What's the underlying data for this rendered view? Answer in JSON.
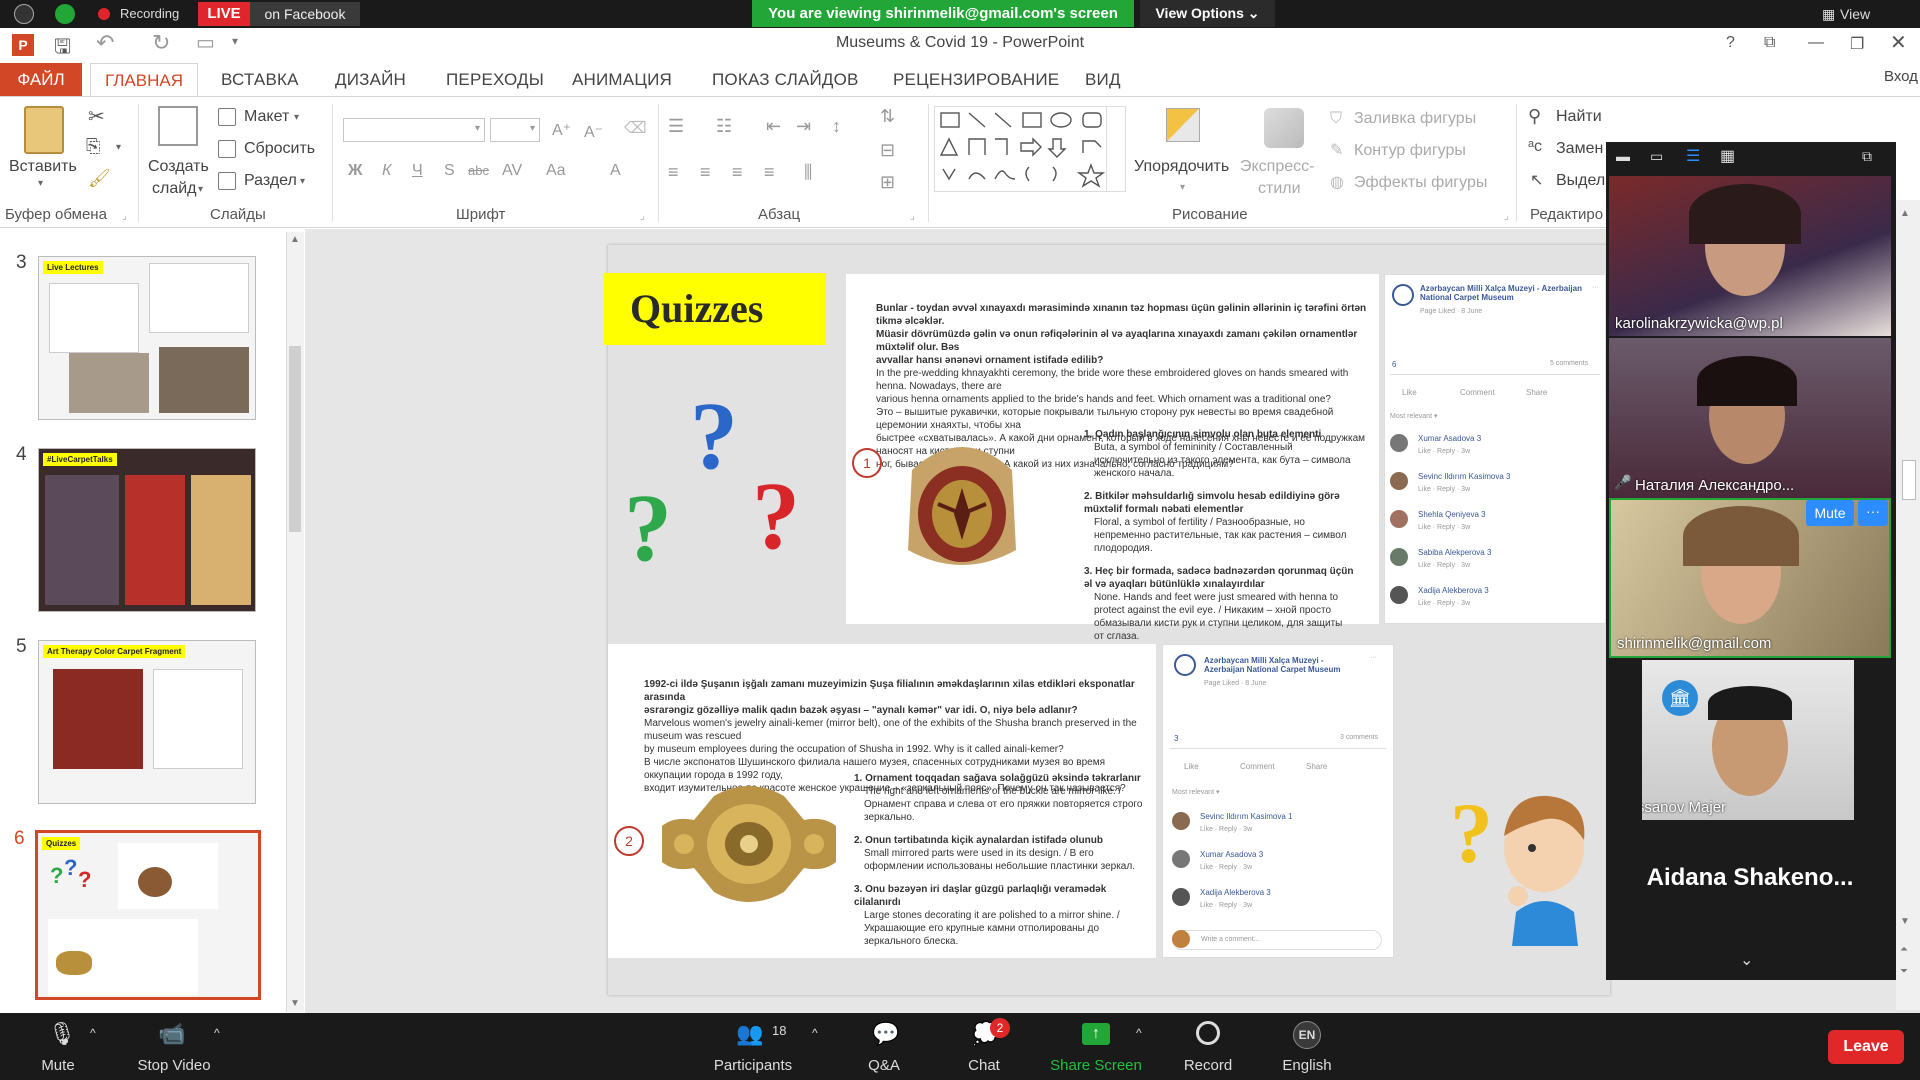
{
  "zoom_top": {
    "recording_label": "Recording",
    "live_label": "LIVE",
    "live_platform": "on Facebook",
    "share_banner": "You are viewing shirinmelik@gmail.com's screen",
    "view_options": "View Options ⌄",
    "view_label": "View"
  },
  "app": {
    "title": "Museums & Covid 19 - PowerPoint",
    "login": "Вход"
  },
  "tabs": [
    "ФАЙЛ",
    "ГЛАВНАЯ",
    "ВСТАВКА",
    "ДИЗАЙН",
    "ПЕРЕХОДЫ",
    "АНИМАЦИЯ",
    "ПОКАЗ СЛАЙДОВ",
    "РЕЦЕНЗИРОВАНИЕ",
    "ВИД"
  ],
  "ribbon": {
    "paste": "Вставить",
    "new_slide_1": "Создать",
    "new_slide_2": "слайд",
    "layout": "Макет",
    "reset": "Сбросить",
    "section": "Раздел",
    "arrange": "Упорядочить",
    "quick_styles_1": "Экспресс-",
    "quick_styles_2": "стили",
    "shape_fill": "Заливка фигуры",
    "shape_outline": "Контур фигуры",
    "shape_effects": "Эффекты фигуры",
    "find": "Найти",
    "replace": "Замен",
    "select": "Выдел",
    "groups": {
      "clipboard": "Буфер обмена",
      "slides": "Слайды",
      "font": "Шрифт",
      "paragraph": "Абзац",
      "drawing": "Рисование",
      "editing": "Редактиро"
    },
    "font_buttons": [
      "Ж",
      "К",
      "Ч",
      "S",
      "abc",
      "AV",
      "Aa",
      "A"
    ]
  },
  "thumbnails": [
    {
      "num": "3",
      "tag": "Live Lectures"
    },
    {
      "num": "4",
      "tag": "#LiveCarpetTalks"
    },
    {
      "num": "5",
      "tag": "Art Therapy Color Carpet Fragment"
    },
    {
      "num": "6",
      "tag": "Quizzes"
    }
  ],
  "slide": {
    "title": "Quizzes",
    "q1_num": "1",
    "q2_num": "2",
    "q1_text": [
      "Bunlar - toydan əvvəl xınayaxdı mərasimində xınanın təz hopması üçün gəlinin əllərinin iç tərəfini örtən tikmə əlcəklər.",
      "Müasir dövrümüzdə gəlin və onun rəfiqələrinin əl və ayaqlarına xınayaxdı zamanı çəkilən ornamentlər müxtəlif olur. Bəs",
      "avvallar hansı ənənəvi ornament istifadə edilib?",
      "In the pre-wedding khnayakhti ceremony, the bride wore these embroidered gloves on hands smeared with henna. Nowadays, there are",
      "various henna ornaments applied to the bride's hands and feet. Which ornament was a traditional one?",
      "Это – вышитые рукавички, которые покрывали тыльную сторону рук невесты во время свадебной церемонии хнаяхты, чтобы хна",
      "быстрее «схватывалась». А какой дни орнамент, который в ходе нанесения хны невесте и её подружкам наносят на кисти рук и ступни",
      "ног, бывает самый разный. А какой из них изначально, согласно традициям?"
    ],
    "q1_opts": [
      {
        "t": "1. Qadın başlanğıcının simvolu olan buta elementi",
        "s": "Buta, a symbol of femininity / Составленный исключительно из такого элемента, как бута – символа женского начала."
      },
      {
        "t": "2. Bitkilər məhsuldarlığ simvolu hesab edildiyinə görə müxtəlif formalı nəbati elementlər",
        "s": "Floral, a symbol of fertility / Разнообразные, но непременно растительные, так как растения – символ плодородия."
      },
      {
        "t": "3. Heç bir formada, sadəcə badnəzərdən qorunmaq üçün əl və ayaqları bütünlüklə xınalayırdılar",
        "s": "None. Hands and feet were just smeared with henna to protect against the evil eye. / Никаким – хной просто обмазывали кисти рук и ступни целиком, для защиты от сглаза."
      }
    ],
    "q2_text": [
      "1992-ci ildə Şuşanın işğalı zamanı muzeyimizin Şuşa filialının əməkdaşlarının xilas etdikləri eksponatlar arasında",
      "əsrarəngiz gözəlliyə malik qadın bazək əşyası – \"aynalı kəmər\" var idi. O, niyə belə adlanır?",
      "Marvelous women's jewelry ainali-kemer (mirror belt), one of the exhibits of the Shusha branch preserved in the museum was rescued",
      "by museum employees during the occupation of Shusha in 1992. Why is it called ainali-kemer?",
      "В числе экспонатов Шушинского филиала нашего музея, спасенных сотрудниками музея во время оккупации города в 1992 году,",
      "входит изумительное по красоте женское украшение – «зеркальный пояс». Почему он так называется?"
    ],
    "q2_opts": [
      {
        "t": "1. Ornament toqqadan sağava solağgüzü əksində təkrarlanır",
        "s": "The right and left ornaments of the buckle are mirror-like. / Орнамент справа и слева от его пряжки повторяется строго зеркально."
      },
      {
        "t": "2. Onun tərtibatında kiçik aynalardan istifadə olunub",
        "s": "Small mirrored parts were used in its design. / В его оформлении использованы небольшие пластинки зеркал."
      },
      {
        "t": "3. Onu bəzəyən iri daşlar güzgü parlaqlığı veramədək cilalanırdı",
        "s": "Large stones decorating it are polished to a mirror shine. / Украшающие его крупные камни отполированы до зеркального блеска."
      }
    ],
    "fb_page": "Azərbaycan Milli Xalça Muzeyi - Azerbaijan National Carpet Museum",
    "fb1_page_sub": "Page Liked · 8 June",
    "fb1_reacts": "6",
    "fb1_comments": "5 comments",
    "fb2_page_sub": "Page Liked · 8 June",
    "fb2_reacts": "3",
    "fb2_comments": "3 comments",
    "fb_like": "Like",
    "fb_comment": "Comment",
    "fb_share": "Share",
    "fb_most_relevant": "Most relevant ▾",
    "fb1_commenters": [
      "Xumar Asadova 3",
      "Sevinc Ildırım Kasimova 3",
      "Shehla Qeniyeva 3",
      "Sabiba Alekperova 3",
      "Xadija Alekberova 3"
    ],
    "fb2_commenters": [
      "Sevinc Ildırım Kasimova 1",
      "Xumar Asadova 3",
      "Xadija Alekberova 3"
    ],
    "fb_actions": "Like · Reply · 3w",
    "fb_write": "Write a comment..."
  },
  "gallery": {
    "participants": [
      {
        "name": "karolinakrzywicka@wp.pl"
      },
      {
        "name": "Наталия Александро..."
      },
      {
        "name": "shirinmelik@gmail.com"
      },
      {
        "name": "Massanov Majer"
      }
    ],
    "mute": "Mute",
    "more": "···",
    "big_name": "Aidana  Shakeno..."
  },
  "zoom_bottom": {
    "mute": "Mute",
    "stop_video": "Stop Video",
    "participants": "Participants",
    "participants_count": "18",
    "qa": "Q&A",
    "chat": "Chat",
    "chat_badge": "2",
    "share_screen": "Share Screen",
    "record": "Record",
    "english": "English",
    "en_badge": "EN",
    "leave": "Leave"
  },
  "colors": {
    "accent": "#d24726",
    "zoom_green": "#23a638",
    "zoom_blue": "#2d8cff",
    "live_red": "#e0262c",
    "quiz_yellow": "#ffff00"
  }
}
